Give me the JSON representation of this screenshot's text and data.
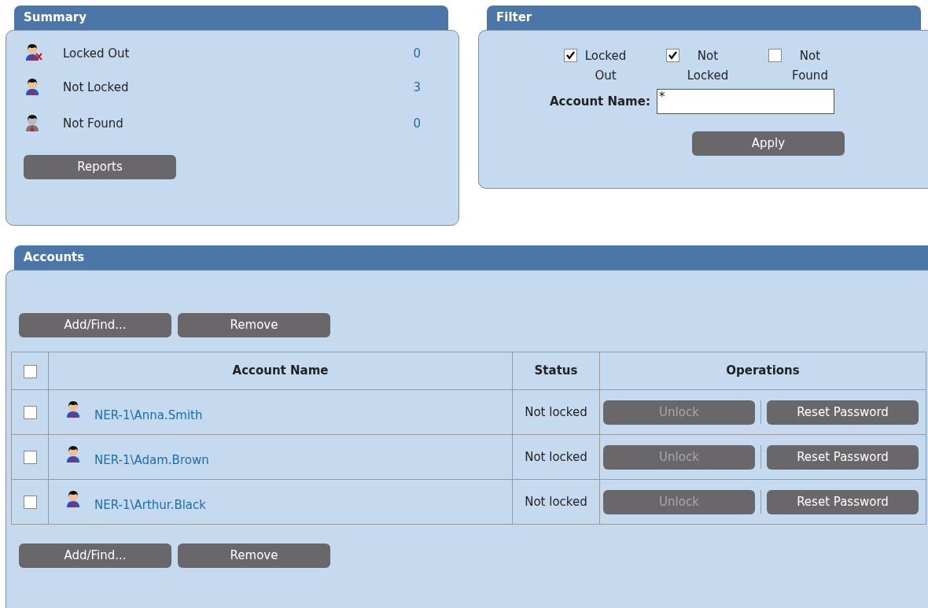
{
  "summary": {
    "title": "Summary",
    "items": [
      {
        "kind": "locked_out",
        "label": "Locked Out",
        "count": "0"
      },
      {
        "kind": "not_locked",
        "label": "Not Locked",
        "count": "3"
      },
      {
        "kind": "not_found",
        "label": "Not Found",
        "count": "0"
      }
    ],
    "button": "Reports"
  },
  "filter": {
    "title": "Filter",
    "options": [
      {
        "label": "Locked Out",
        "checked": true
      },
      {
        "label": "Not Locked",
        "checked": true
      },
      {
        "label": "Not Found",
        "checked": false
      }
    ],
    "account_name": {
      "label": "Account Name:",
      "value": "*"
    },
    "button": "Apply"
  },
  "accounts": {
    "title": "Accounts",
    "toolbar_top": [
      "Add/Find...",
      "Remove"
    ],
    "table": {
      "select_all_checked": false,
      "columns": [
        "Account Name",
        "Status",
        "Operations"
      ],
      "rows": [
        {
          "checked": false,
          "kind": "not_locked",
          "name": "NER-1\\Anna.Smith",
          "status": "Not locked",
          "operations": [
            {
              "label": "Unlock",
              "disabled": true
            },
            {
              "label": "Reset Password",
              "disabled": false
            }
          ]
        },
        {
          "checked": false,
          "kind": "not_locked",
          "name": "NER-1\\Adam.Brown",
          "status": "Not locked",
          "operations": [
            {
              "label": "Unlock",
              "disabled": true
            },
            {
              "label": "Reset Password",
              "disabled": false
            }
          ]
        },
        {
          "checked": false,
          "kind": "not_locked",
          "name": "NER-1\\Arthur.Black",
          "status": "Not locked",
          "operations": [
            {
              "label": "Unlock",
              "disabled": true
            },
            {
              "label": "Reset Password",
              "disabled": false
            }
          ]
        }
      ]
    },
    "toolbar_bottom": [
      "Add/Find...",
      "Remove"
    ]
  }
}
